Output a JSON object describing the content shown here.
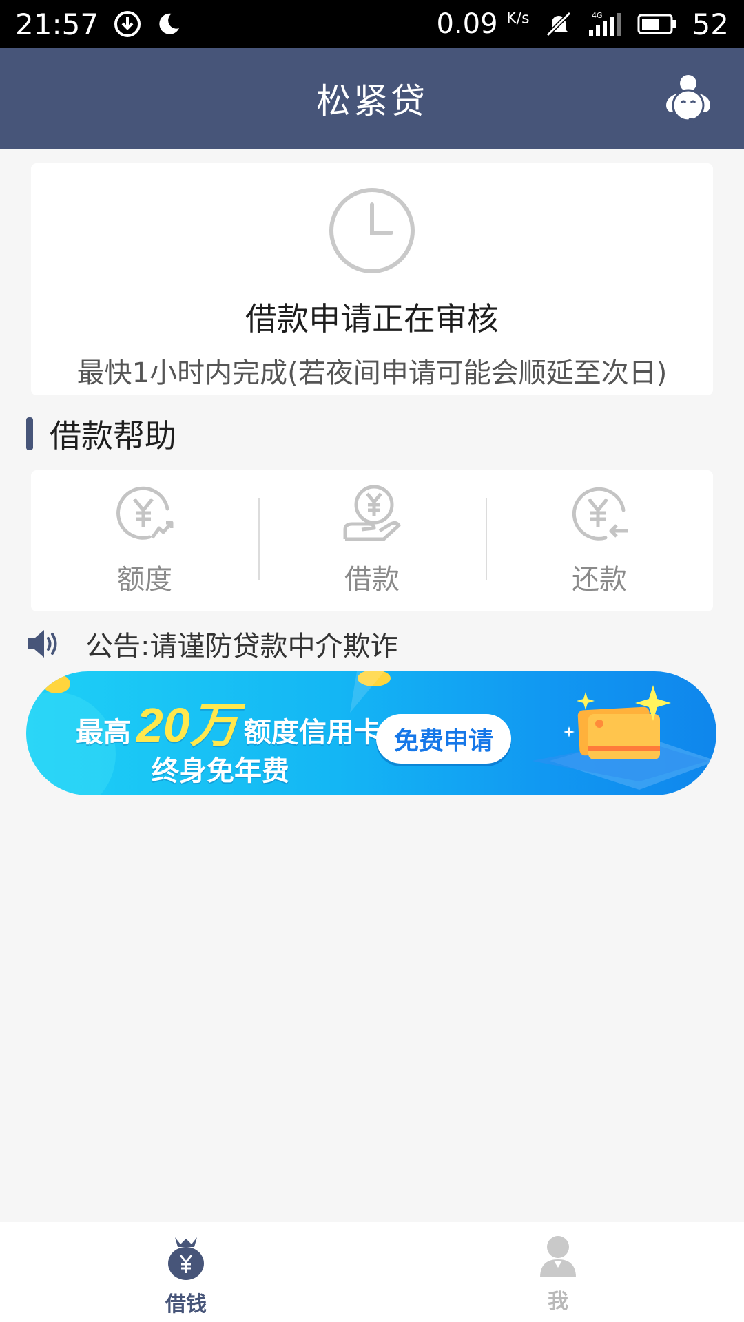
{
  "status_bar": {
    "time": "21:57",
    "speed": "0.09",
    "speed_unit": "K/s",
    "network": "4G",
    "battery": "52",
    "icons": [
      "download-icon",
      "moon-icon",
      "mute-icon",
      "signal-icon",
      "battery-icon"
    ]
  },
  "header": {
    "title": "松紧贷",
    "right_icon": "customer-service-icon"
  },
  "review": {
    "icon": "clock-icon",
    "title": "借款申请正在审核",
    "subtitle": "最快1小时内完成(若夜间申请可能会顺延至次日)"
  },
  "help": {
    "heading": "借款帮助",
    "items": [
      {
        "label": "额度",
        "icon": "yen-growth-icon"
      },
      {
        "label": "借款",
        "icon": "yen-hand-icon"
      },
      {
        "label": "还款",
        "icon": "yen-return-icon"
      }
    ]
  },
  "notice": {
    "icon": "speaker-icon",
    "text": "公告:请谨防贷款中介欺诈"
  },
  "banner": {
    "prefix": "最高",
    "amount": "20万",
    "suffix": "额度信用卡",
    "line2": "终身免年费",
    "button": "免费申请"
  },
  "tabs": [
    {
      "label": "借钱",
      "icon": "money-bag-icon",
      "active": true
    },
    {
      "label": "我",
      "icon": "user-icon",
      "active": false
    }
  ],
  "colors": {
    "primary": "#475579",
    "background": "#f6f6f6",
    "banner_button_text": "#1677e8",
    "banner_highlight": "#ffe84d"
  }
}
